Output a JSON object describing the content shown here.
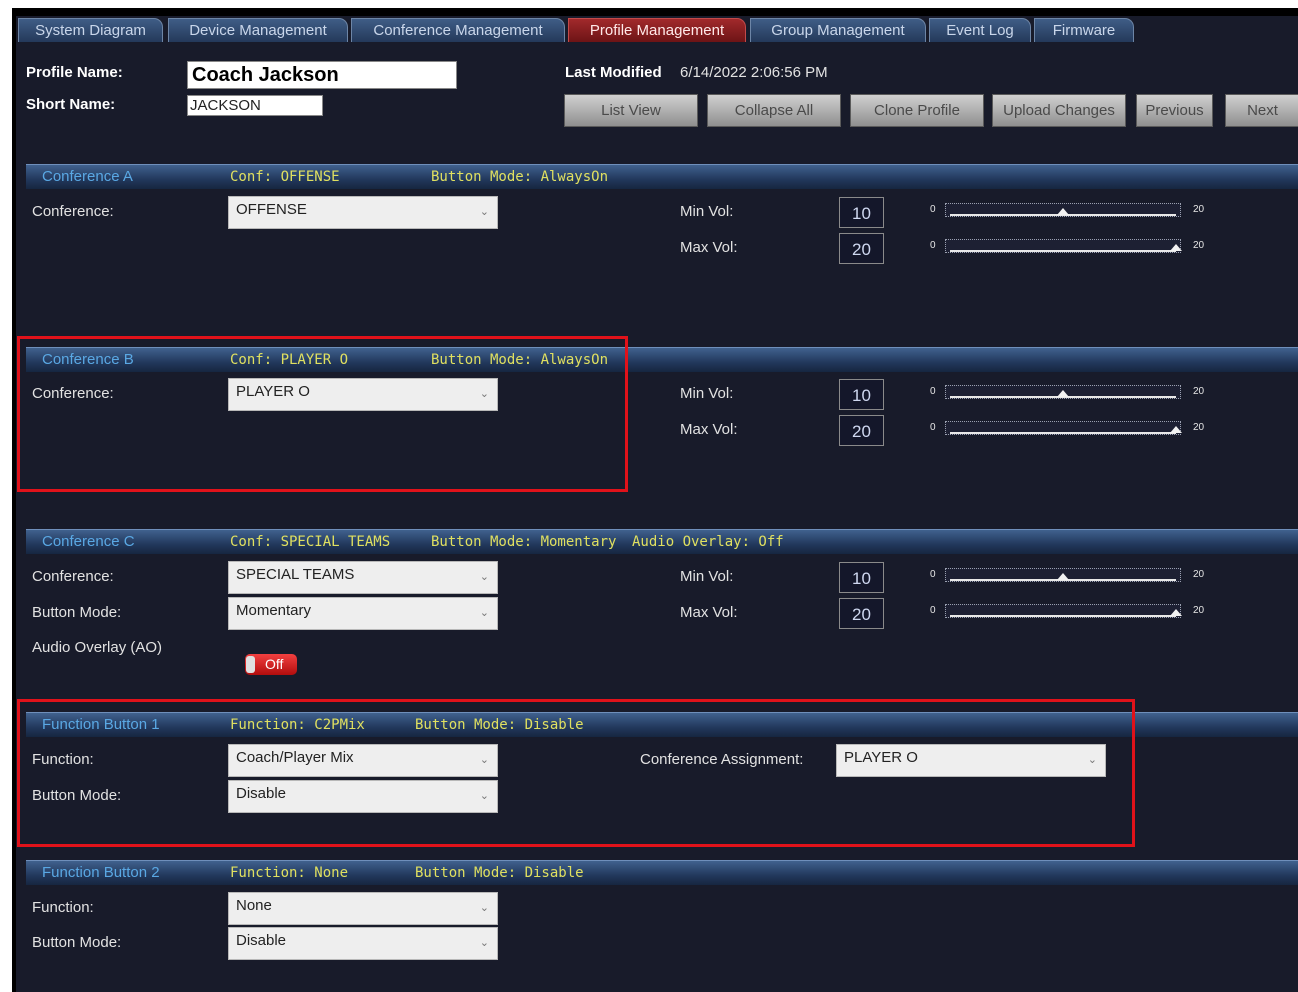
{
  "tabs": [
    {
      "label": "System Diagram",
      "active": false
    },
    {
      "label": "Device Management",
      "active": false
    },
    {
      "label": "Conference Management",
      "active": false
    },
    {
      "label": "Profile Management",
      "active": true
    },
    {
      "label": "Group Management",
      "active": false
    },
    {
      "label": "Event Log",
      "active": false
    },
    {
      "label": "Firmware",
      "active": false
    }
  ],
  "profile": {
    "name_label": "Profile Name:",
    "name_value": "Coach Jackson",
    "short_label": "Short Name:",
    "short_value": "JACKSON",
    "last_modified_label": "Last Modified",
    "last_modified_value": "6/14/2022 2:06:56 PM"
  },
  "toolbar": {
    "list_view": "List View",
    "collapse_all": "Collapse All",
    "clone_profile": "Clone Profile",
    "upload_changes": "Upload Changes",
    "previous": "Previous",
    "next": "Next"
  },
  "labels": {
    "conference": "Conference:",
    "button_mode": "Button Mode:",
    "audio_overlay": "Audio Overlay (AO)",
    "function": "Function:",
    "conference_assignment": "Conference Assignment:",
    "min_vol": "Min Vol:",
    "max_vol": "Max Vol:",
    "slider_min": "0",
    "slider_max": "20"
  },
  "sections": {
    "conf_a": {
      "title": "Conference A",
      "conf_info": "Conf: OFFENSE",
      "mode_info": "Button Mode: AlwaysOn",
      "conference_value": "OFFENSE",
      "min_vol": "10",
      "max_vol": "20",
      "min_level": 0.5,
      "max_level": 1.0
    },
    "conf_b": {
      "title": "Conference B",
      "conf_info": "Conf: PLAYER O",
      "mode_info": "Button Mode: AlwaysOn",
      "conference_value": "PLAYER O",
      "min_vol": "10",
      "max_vol": "20",
      "min_level": 0.5,
      "max_level": 1.0
    },
    "conf_c": {
      "title": "Conference C",
      "conf_info": "Conf: SPECIAL TEAMS",
      "mode_info": "Button Mode: Momentary",
      "overlay_info": "Audio Overlay: Off",
      "conference_value": "SPECIAL TEAMS",
      "button_mode_value": "Momentary",
      "audio_overlay_state": "Off",
      "min_vol": "10",
      "max_vol": "20",
      "min_level": 0.5,
      "max_level": 1.0
    },
    "func_1": {
      "title": "Function Button 1",
      "func_info": "Function: C2PMix",
      "mode_info": "Button Mode: Disable",
      "function_value": "Coach/Player Mix",
      "button_mode_value": "Disable",
      "conference_assignment_value": "PLAYER O"
    },
    "func_2": {
      "title": "Function Button 2",
      "func_info": "Function: None",
      "mode_info": "Button Mode: Disable",
      "function_value": "None",
      "button_mode_value": "Disable"
    }
  },
  "colors": {
    "highlight_box": "#e0121a",
    "active_tab": "#a1292b",
    "section_title": "#5aa8e4",
    "section_info": "#e0e060"
  }
}
